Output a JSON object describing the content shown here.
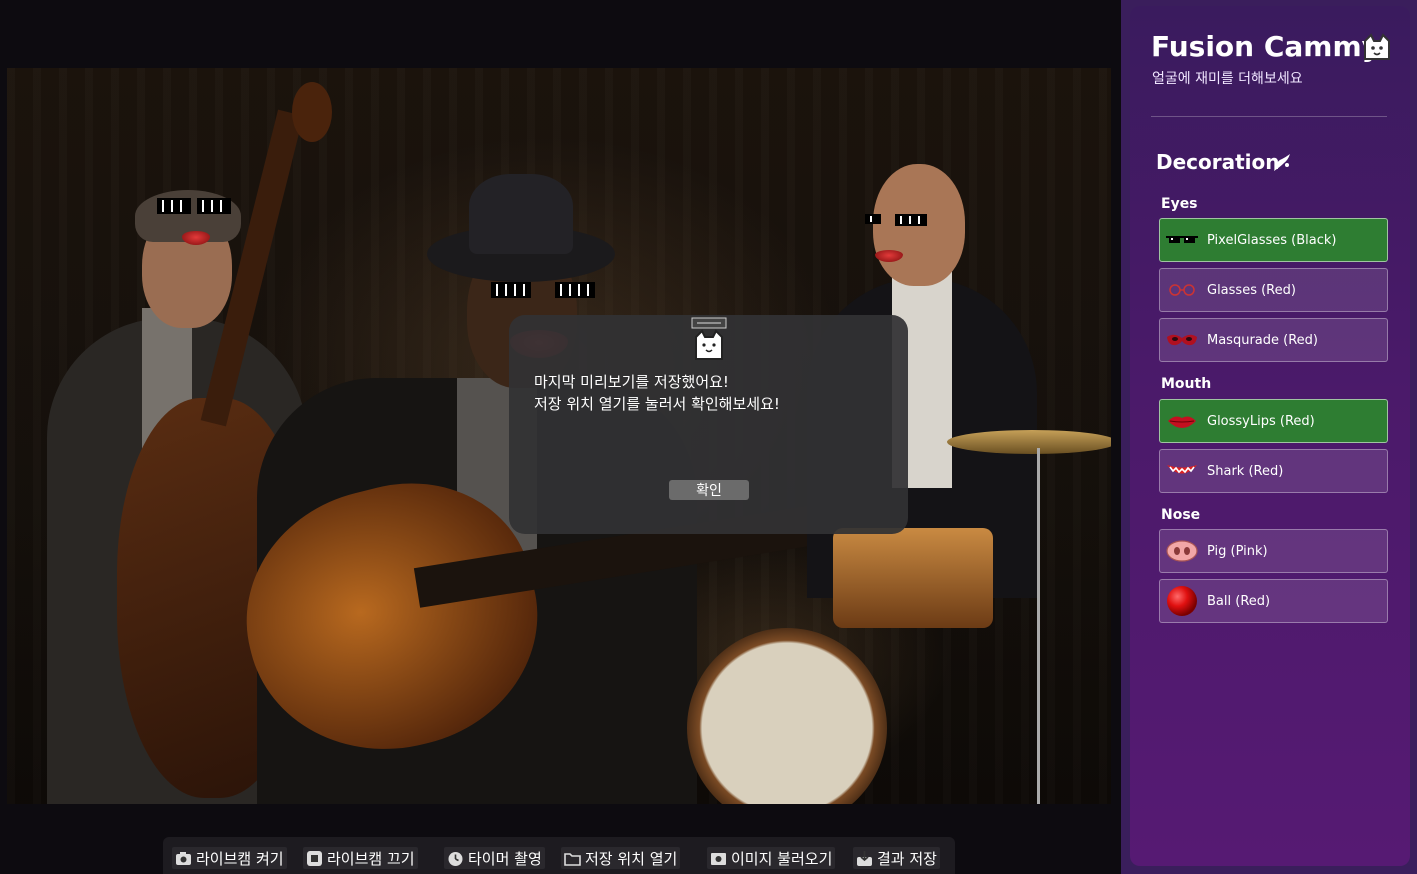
{
  "app": {
    "title": "Fusion Cammy",
    "subtitle": "얼굴에 재미를 더해보세요"
  },
  "decoration": {
    "title": "Decoration",
    "sections": [
      {
        "label": "Eyes",
        "items": [
          {
            "label": "PixelGlasses (Black)",
            "icon": "pixel-glasses-icon",
            "selected": true
          },
          {
            "label": "Glasses (Red)",
            "icon": "red-glasses-icon",
            "selected": false
          },
          {
            "label": "Masqurade (Red)",
            "icon": "masquerade-mask-icon",
            "selected": false
          }
        ]
      },
      {
        "label": "Mouth",
        "items": [
          {
            "label": "GlossyLips (Red)",
            "icon": "glossy-lips-icon",
            "selected": true
          },
          {
            "label": "Shark (Red)",
            "icon": "shark-mouth-icon",
            "selected": false
          }
        ]
      },
      {
        "label": "Nose",
        "items": [
          {
            "label": "Pig (Pink)",
            "icon": "pig-nose-icon",
            "selected": false
          },
          {
            "label": "Ball (Red)",
            "icon": "red-ball-nose-icon",
            "selected": false
          }
        ]
      }
    ]
  },
  "modal": {
    "line1": "마지막 미리보기를 저장했어요!",
    "line2": "저장 위치 열기를 눌러서 확인해보세요!",
    "ok_label": "확인",
    "icon": "cat-face-icon"
  },
  "toolbar": {
    "live_on": "라이브캠 켜기",
    "live_off": "라이브캠 끄기",
    "timer": "타이머 촬영",
    "open_folder": "저장 위치 열기",
    "load_image": "이미지 불러오기",
    "save_result": "결과 저장"
  },
  "colors": {
    "selected": "#2e7d32",
    "panel": "#4b1a6a",
    "modal": "#323234"
  }
}
